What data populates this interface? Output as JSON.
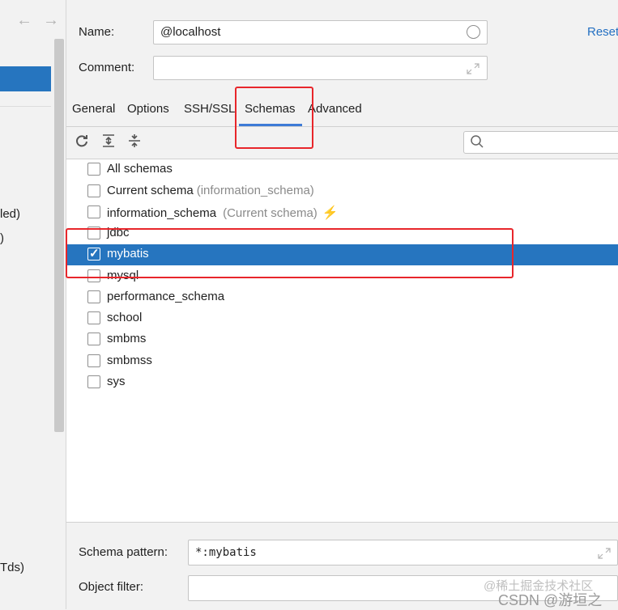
{
  "sidebar": {
    "nav_back": "←",
    "nav_forward": "→",
    "fragments": [
      "led)",
      ")",
      "Tds)"
    ]
  },
  "form": {
    "name_label": "Name:",
    "name_value": "@localhost",
    "reset_label": "Reset",
    "comment_label": "Comment:",
    "comment_value": ""
  },
  "tabs": [
    {
      "label": "General"
    },
    {
      "label": "Options"
    },
    {
      "label": "SSH/SSL"
    },
    {
      "label": "Schemas",
      "active": true
    },
    {
      "label": "Advanced"
    }
  ],
  "toolbar": {
    "refresh_icon": "refresh-icon",
    "expand_all_icon": "expand-all-icon",
    "collapse_all_icon": "collapse-all-icon",
    "search_placeholder": ""
  },
  "schemas": [
    {
      "name": "All schemas",
      "hint": "",
      "checked": false
    },
    {
      "name": "Current schema",
      "hint": "(information_schema)",
      "checked": false
    },
    {
      "name": "information_schema",
      "hint": "(Current schema)",
      "checked": false
    },
    {
      "name": "jdbc",
      "hint": "",
      "checked": false
    },
    {
      "name": "mybatis",
      "hint": "",
      "checked": true
    },
    {
      "name": "mysql",
      "hint": "",
      "checked": false
    },
    {
      "name": "performance_schema",
      "hint": "",
      "checked": false
    },
    {
      "name": "school",
      "hint": "",
      "checked": false
    },
    {
      "name": "smbms",
      "hint": "",
      "checked": false
    },
    {
      "name": "smbmss",
      "hint": "",
      "checked": false
    },
    {
      "name": "sys",
      "hint": "",
      "checked": false
    }
  ],
  "bottom": {
    "schema_pattern_label": "Schema pattern:",
    "schema_pattern_value": "*:mybatis",
    "object_filter_label": "Object filter:",
    "object_filter_value": ""
  },
  "watermark": {
    "line1": "@稀土掘金技术社区",
    "line2": "CSDN @游垣之"
  },
  "colors": {
    "selection": "#2675bf",
    "highlight_box": "#e8262b",
    "link": "#2470c2",
    "bolt": "#f0a30a"
  }
}
